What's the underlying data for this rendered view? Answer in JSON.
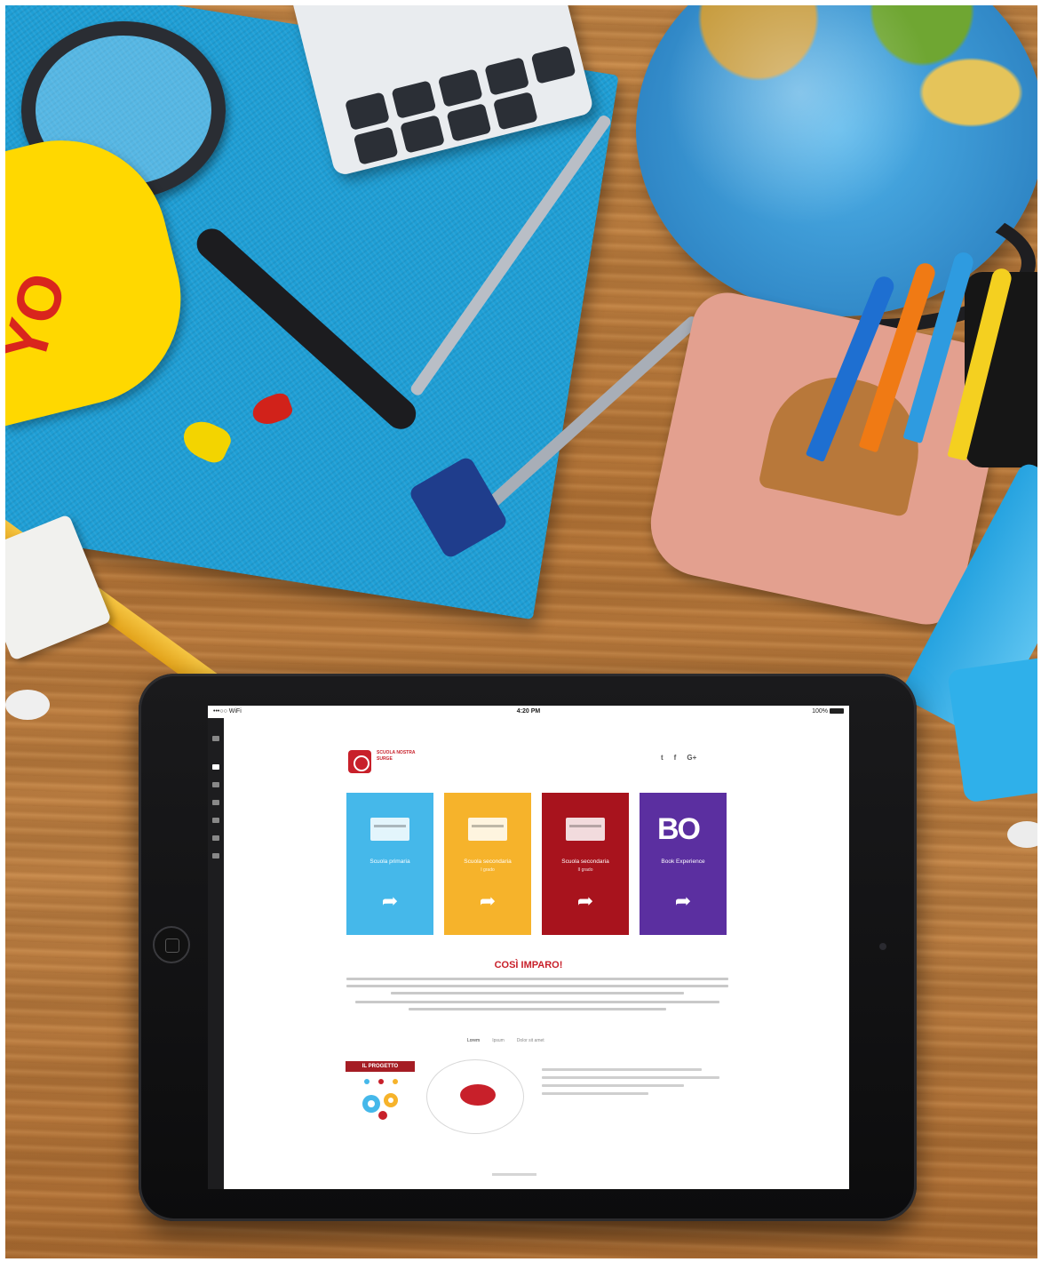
{
  "scene": {
    "flashcard_text": "YO",
    "wood_color": "#c08044",
    "notebook_color": "#1f9fd6"
  },
  "status_bar": {
    "carrier": "•••○○ WiFi",
    "time": "4:20 PM",
    "battery": "100%"
  },
  "site": {
    "logo_text": "SCUOLA NOSTRA SURGE",
    "social": [
      "t",
      "f",
      "G+"
    ],
    "tiles": [
      {
        "title": "Scuola primaria",
        "subtitle": "",
        "color": "#45b8ea"
      },
      {
        "title": "Scuola secondaria",
        "subtitle": "I grado",
        "color": "#f6b32b"
      },
      {
        "title": "Scuola secondaria",
        "subtitle": "II grado",
        "color": "#a8131d"
      },
      {
        "title": "Book Experience",
        "subtitle": "",
        "color": "#5b2fa0",
        "logo": "BO"
      }
    ],
    "section_title": "COSÌ IMPARO!",
    "project_label": "IL PROGETTO",
    "tabs": [
      "Lorem",
      "Ipsum",
      "Dolor sit amet"
    ]
  },
  "icons": {
    "tile_arrow": "share-arrow-icon",
    "home": "home-button-icon"
  }
}
